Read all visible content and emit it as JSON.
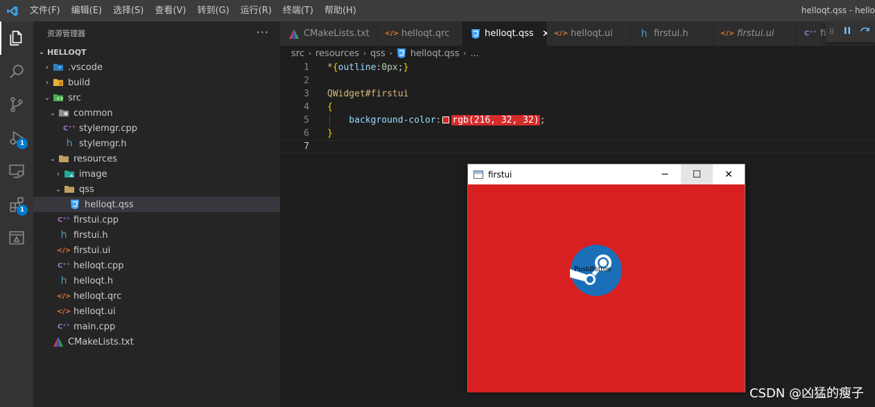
{
  "titlebar": {
    "menu": [
      "文件(F)",
      "编辑(E)",
      "选择(S)",
      "查看(V)",
      "转到(G)",
      "运行(R)",
      "终端(T)",
      "帮助(H)"
    ],
    "window_title": "helloqt.qss - hello"
  },
  "activity": {
    "items": [
      "explorer-icon",
      "search-icon",
      "source-control-icon",
      "run-debug-icon",
      "remote-explorer-icon",
      "extensions-icon",
      "cmake-icon"
    ],
    "badges": {
      "debug": "1",
      "extensions": "1"
    }
  },
  "sidebar": {
    "header": "资源管理器",
    "more": "···",
    "root": "HELLOQT",
    "tree": [
      {
        "label": ".vscode",
        "depth": 0,
        "chevron": "›",
        "icon": "vscode-folder-icon"
      },
      {
        "label": "build",
        "depth": 0,
        "chevron": "›",
        "icon": "build-folder-icon"
      },
      {
        "label": "src",
        "depth": 0,
        "chevron": "⌄",
        "icon": "src-folder-icon"
      },
      {
        "label": "common",
        "depth": 1,
        "chevron": "⌄",
        "icon": "common-folder-icon"
      },
      {
        "label": "stylemgr.cpp",
        "depth": 2,
        "chevron": "",
        "icon": "cpp-file-icon"
      },
      {
        "label": "stylemgr.h",
        "depth": 2,
        "chevron": "",
        "icon": "h-file-icon"
      },
      {
        "label": "resources",
        "depth": 1,
        "chevron": "⌄",
        "icon": "resources-folder-icon"
      },
      {
        "label": "image",
        "depth": 2,
        "chevron": "›",
        "icon": "image-folder-icon"
      },
      {
        "label": "qss",
        "depth": 2,
        "chevron": "⌄",
        "icon": "qss-folder-icon"
      },
      {
        "label": "helloqt.qss",
        "depth": 3,
        "chevron": "",
        "icon": "css-file-icon",
        "selected": true
      },
      {
        "label": "firstui.cpp",
        "depth": 1,
        "chevron": "",
        "icon": "cpp-file-icon"
      },
      {
        "label": "firstui.h",
        "depth": 1,
        "chevron": "",
        "icon": "h-file-icon"
      },
      {
        "label": "firstui.ui",
        "depth": 1,
        "chevron": "",
        "icon": "xml-file-icon"
      },
      {
        "label": "helloqt.cpp",
        "depth": 1,
        "chevron": "",
        "icon": "cpp-file-icon"
      },
      {
        "label": "helloqt.h",
        "depth": 1,
        "chevron": "",
        "icon": "h-file-icon"
      },
      {
        "label": "helloqt.qrc",
        "depth": 1,
        "chevron": "",
        "icon": "xml-file-icon"
      },
      {
        "label": "helloqt.ui",
        "depth": 1,
        "chevron": "",
        "icon": "xml-file-icon"
      },
      {
        "label": "main.cpp",
        "depth": 1,
        "chevron": "",
        "icon": "cpp-file-icon"
      },
      {
        "label": "CMakeLists.txt",
        "depth": 0,
        "chevron": "",
        "icon": "cmake-file-icon"
      }
    ]
  },
  "tabs": [
    {
      "label": "CMakeLists.txt",
      "icon": "cmake-file-icon",
      "active": false,
      "italic": false
    },
    {
      "label": "helloqt.qrc",
      "icon": "xml-file-icon",
      "active": false,
      "italic": false
    },
    {
      "label": "helloqt.qss",
      "icon": "css-file-icon",
      "active": true,
      "italic": false,
      "close": "✕"
    },
    {
      "label": "helloqt.ui",
      "icon": "xml-file-icon",
      "active": false,
      "italic": false
    },
    {
      "label": "firstui.h",
      "icon": "h-file-icon",
      "active": false,
      "italic": false
    },
    {
      "label": "firstui.ui",
      "icon": "xml-file-icon",
      "active": false,
      "italic": true
    },
    {
      "label": "fi",
      "icon": "cpp-file-icon",
      "active": false,
      "italic": false
    }
  ],
  "breadcrumb": [
    "src",
    "resources",
    "qss",
    "helloqt.qss",
    "..."
  ],
  "editor": {
    "lines": [
      {
        "n": "1",
        "tokens": [
          {
            "t": "*",
            "c": "tok-sel"
          },
          {
            "t": "{",
            "c": "tok-brace"
          },
          {
            "t": "outline",
            "c": "tok-prop"
          },
          {
            "t": ":",
            "c": "tok-punc"
          },
          {
            "t": "0px",
            "c": "tok-val"
          },
          {
            "t": ";",
            "c": "tok-punc"
          },
          {
            "t": "}",
            "c": "tok-brace"
          }
        ]
      },
      {
        "n": "2",
        "tokens": []
      },
      {
        "n": "3",
        "tokens": [
          {
            "t": "QWidget#firstui",
            "c": "tok-sel"
          }
        ]
      },
      {
        "n": "4",
        "tokens": [
          {
            "t": "{",
            "c": "tok-brace"
          }
        ]
      },
      {
        "n": "5",
        "tokens": [
          {
            "t": "    background-color",
            "c": "tok-prop"
          },
          {
            "t": ":",
            "c": "tok-punc"
          },
          {
            "t": "",
            "c": "swatch"
          },
          {
            "t": "rgb(216, 32, 32)",
            "c": "tok-rgb"
          },
          {
            "t": ";",
            "c": "tok-punc"
          }
        ]
      },
      {
        "n": "6",
        "tokens": [
          {
            "t": "}",
            "c": "tok-brace"
          }
        ]
      },
      {
        "n": "7",
        "tokens": [],
        "current": true
      }
    ]
  },
  "qtwindow": {
    "title": "firstui",
    "minimize": "─",
    "maximize": "☐",
    "close": "✕",
    "background": "#d82020",
    "button_label": "PushButton"
  },
  "colors": {
    "accent": "#007acc",
    "qss_red": "#d82020"
  },
  "watermark": "CSDN @凶猛的瘦子"
}
